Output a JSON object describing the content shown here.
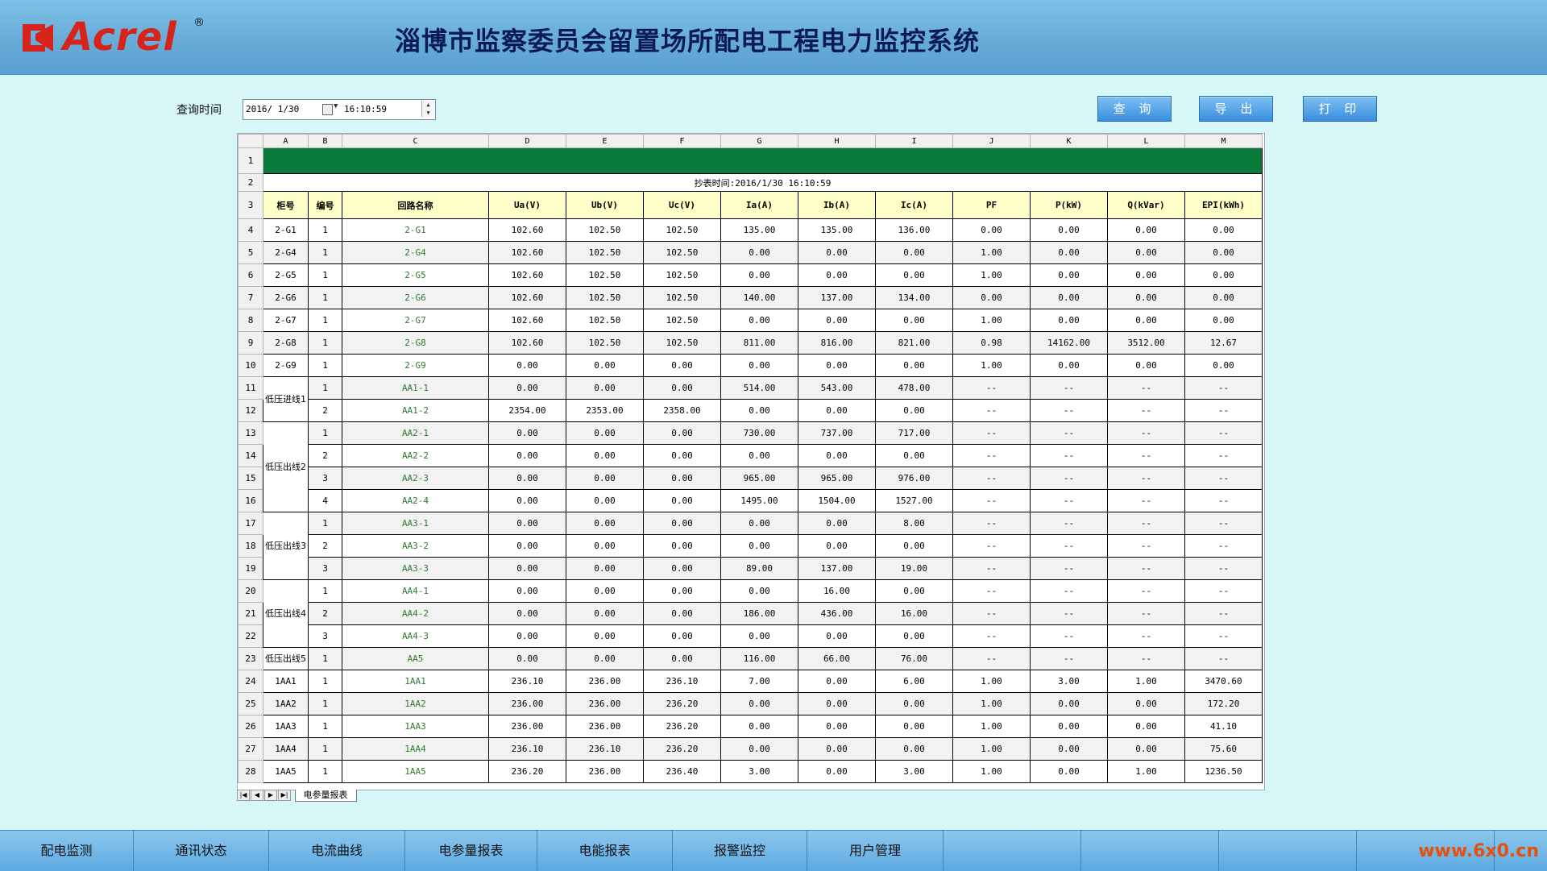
{
  "app": {
    "logo_text": "Acrel",
    "logo_reg": "®",
    "title": "淄博市监察委员会留置场所配电工程电力监控系统"
  },
  "query": {
    "label": "查询时间",
    "date": "2016/ 1/30",
    "time": "16:10:59"
  },
  "buttons": {
    "query": "查 询",
    "export": "导 出",
    "print": "打 印"
  },
  "sheet": {
    "column_letters": [
      "A",
      "B",
      "C",
      "D",
      "E",
      "F",
      "G",
      "H",
      "I",
      "J",
      "K",
      "L",
      "M"
    ],
    "title_row_label": "抄表时间:2016/1/30 16:10:59",
    "headers": [
      "柜号",
      "编号",
      "回路名称",
      "Ua(V)",
      "Ub(V)",
      "Uc(V)",
      "Ia(A)",
      "Ib(A)",
      "Ic(A)",
      "PF",
      "P(kW)",
      "Q(kVar)",
      "EPI(kWh)"
    ],
    "row_numbers": [
      "1",
      "2",
      "3",
      "4",
      "5",
      "6",
      "7",
      "8",
      "9",
      "10",
      "11",
      "12",
      "13",
      "14",
      "15",
      "16",
      "17",
      "18",
      "19",
      "20",
      "21",
      "22",
      "23",
      "24",
      "25",
      "26",
      "27",
      "28"
    ],
    "groups": [
      {
        "label": "低压进线1",
        "start": 11,
        "span": 2
      },
      {
        "label": "低压出线2",
        "start": 13,
        "span": 4
      },
      {
        "label": "低压出线3",
        "start": 17,
        "span": 3
      },
      {
        "label": "低压出线4",
        "start": 20,
        "span": 3
      },
      {
        "label": "低压出线5",
        "start": 23,
        "span": 1
      }
    ],
    "rows": [
      [
        "2-G1",
        "1",
        "2-G1",
        "102.60",
        "102.50",
        "102.50",
        "135.00",
        "135.00",
        "136.00",
        "0.00",
        "0.00",
        "0.00",
        "0.00"
      ],
      [
        "2-G4",
        "1",
        "2-G4",
        "102.60",
        "102.50",
        "102.50",
        "0.00",
        "0.00",
        "0.00",
        "1.00",
        "0.00",
        "0.00",
        "0.00"
      ],
      [
        "2-G5",
        "1",
        "2-G5",
        "102.60",
        "102.50",
        "102.50",
        "0.00",
        "0.00",
        "0.00",
        "1.00",
        "0.00",
        "0.00",
        "0.00"
      ],
      [
        "2-G6",
        "1",
        "2-G6",
        "102.60",
        "102.50",
        "102.50",
        "140.00",
        "137.00",
        "134.00",
        "0.00",
        "0.00",
        "0.00",
        "0.00"
      ],
      [
        "2-G7",
        "1",
        "2-G7",
        "102.60",
        "102.50",
        "102.50",
        "0.00",
        "0.00",
        "0.00",
        "1.00",
        "0.00",
        "0.00",
        "0.00"
      ],
      [
        "2-G8",
        "1",
        "2-G8",
        "102.60",
        "102.50",
        "102.50",
        "811.00",
        "816.00",
        "821.00",
        "0.98",
        "14162.00",
        "3512.00",
        "12.67"
      ],
      [
        "2-G9",
        "1",
        "2-G9",
        "0.00",
        "0.00",
        "0.00",
        "0.00",
        "0.00",
        "0.00",
        "1.00",
        "0.00",
        "0.00",
        "0.00"
      ],
      [
        "",
        "1",
        "AA1-1",
        "0.00",
        "0.00",
        "0.00",
        "514.00",
        "543.00",
        "478.00",
        "--",
        "--",
        "--",
        "--"
      ],
      [
        "",
        "2",
        "AA1-2",
        "2354.00",
        "2353.00",
        "2358.00",
        "0.00",
        "0.00",
        "0.00",
        "--",
        "--",
        "--",
        "--"
      ],
      [
        "",
        "1",
        "AA2-1",
        "0.00",
        "0.00",
        "0.00",
        "730.00",
        "737.00",
        "717.00",
        "--",
        "--",
        "--",
        "--"
      ],
      [
        "",
        "2",
        "AA2-2",
        "0.00",
        "0.00",
        "0.00",
        "0.00",
        "0.00",
        "0.00",
        "--",
        "--",
        "--",
        "--"
      ],
      [
        "",
        "3",
        "AA2-3",
        "0.00",
        "0.00",
        "0.00",
        "965.00",
        "965.00",
        "976.00",
        "--",
        "--",
        "--",
        "--"
      ],
      [
        "",
        "4",
        "AA2-4",
        "0.00",
        "0.00",
        "0.00",
        "1495.00",
        "1504.00",
        "1527.00",
        "--",
        "--",
        "--",
        "--"
      ],
      [
        "",
        "1",
        "AA3-1",
        "0.00",
        "0.00",
        "0.00",
        "0.00",
        "0.00",
        "8.00",
        "--",
        "--",
        "--",
        "--"
      ],
      [
        "",
        "2",
        "AA3-2",
        "0.00",
        "0.00",
        "0.00",
        "0.00",
        "0.00",
        "0.00",
        "--",
        "--",
        "--",
        "--"
      ],
      [
        "",
        "3",
        "AA3-3",
        "0.00",
        "0.00",
        "0.00",
        "89.00",
        "137.00",
        "19.00",
        "--",
        "--",
        "--",
        "--"
      ],
      [
        "",
        "1",
        "AA4-1",
        "0.00",
        "0.00",
        "0.00",
        "0.00",
        "16.00",
        "0.00",
        "--",
        "--",
        "--",
        "--"
      ],
      [
        "",
        "2",
        "AA4-2",
        "0.00",
        "0.00",
        "0.00",
        "186.00",
        "436.00",
        "16.00",
        "--",
        "--",
        "--",
        "--"
      ],
      [
        "",
        "3",
        "AA4-3",
        "0.00",
        "0.00",
        "0.00",
        "0.00",
        "0.00",
        "0.00",
        "--",
        "--",
        "--",
        "--"
      ],
      [
        "",
        "1",
        "AA5",
        "0.00",
        "0.00",
        "0.00",
        "116.00",
        "66.00",
        "76.00",
        "--",
        "--",
        "--",
        "--"
      ],
      [
        "1AA1",
        "1",
        "1AA1",
        "236.10",
        "236.00",
        "236.10",
        "7.00",
        "0.00",
        "6.00",
        "1.00",
        "3.00",
        "1.00",
        "3470.60"
      ],
      [
        "1AA2",
        "1",
        "1AA2",
        "236.00",
        "236.00",
        "236.20",
        "0.00",
        "0.00",
        "0.00",
        "1.00",
        "0.00",
        "0.00",
        "172.20"
      ],
      [
        "1AA3",
        "1",
        "1AA3",
        "236.00",
        "236.00",
        "236.20",
        "0.00",
        "0.00",
        "0.00",
        "1.00",
        "0.00",
        "0.00",
        "41.10"
      ],
      [
        "1AA4",
        "1",
        "1AA4",
        "236.10",
        "236.10",
        "236.20",
        "0.00",
        "0.00",
        "0.00",
        "1.00",
        "0.00",
        "0.00",
        "75.60"
      ],
      [
        "1AA5",
        "1",
        "1AA5",
        "236.20",
        "236.00",
        "236.40",
        "3.00",
        "0.00",
        "3.00",
        "1.00",
        "0.00",
        "1.00",
        "1236.50"
      ]
    ],
    "tab_label": "电参量报表"
  },
  "nav": [
    "配电监测",
    "通讯状态",
    "电流曲线",
    "电参量报表",
    "电能报表",
    "报警监控",
    "用户管理",
    "",
    "",
    "",
    ""
  ],
  "watermark": "www.6x0.cn",
  "colors": {
    "header_bg": "#67acd8",
    "page_bg": "#d7f7f7",
    "title_band": "#0a7a3a",
    "header_cells": "#ffffc8",
    "name_text": "#2d7a2d"
  }
}
